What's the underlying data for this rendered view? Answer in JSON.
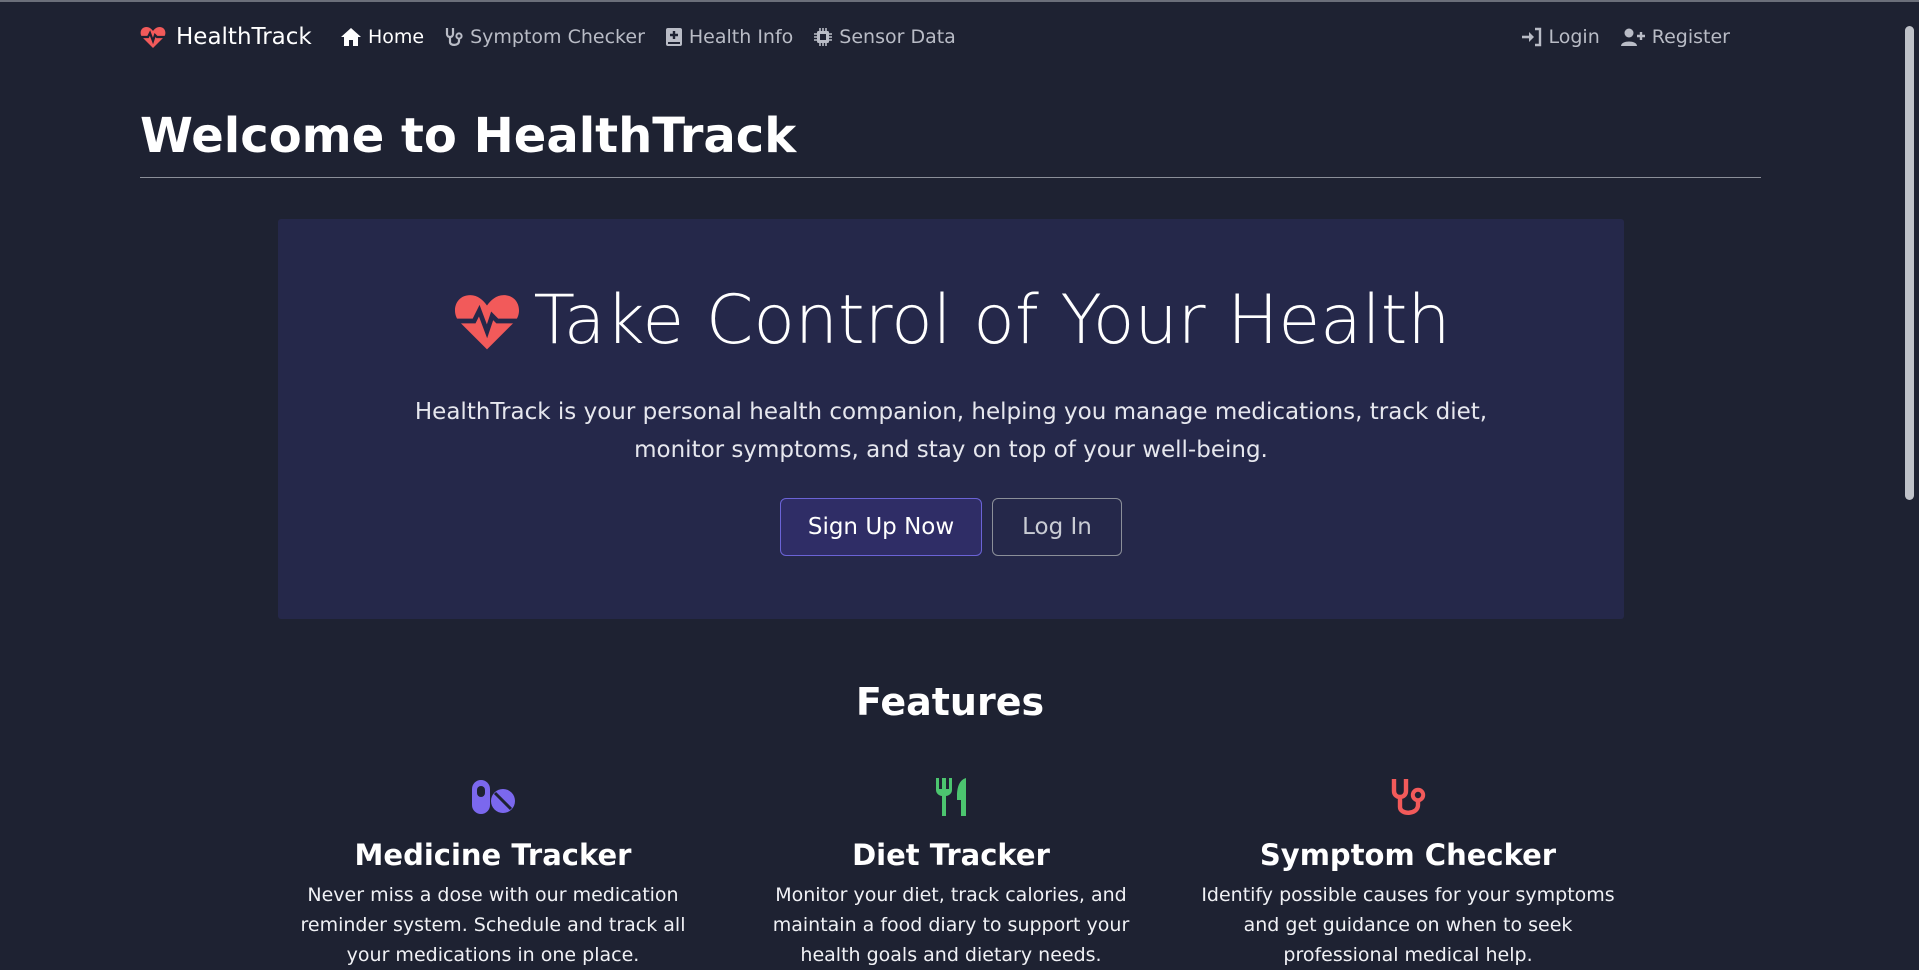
{
  "navbar": {
    "brand": "HealthTrack",
    "links": [
      {
        "label": "Home",
        "icon": "home-icon"
      },
      {
        "label": "Symptom Checker",
        "icon": "stethoscope-icon"
      },
      {
        "label": "Health Info",
        "icon": "medical-book-icon"
      },
      {
        "label": "Sensor Data",
        "icon": "chip-icon"
      }
    ],
    "login": "Login",
    "register": "Register"
  },
  "page": {
    "title": "Welcome to HealthTrack"
  },
  "hero": {
    "title": "Take Control of Your Health",
    "text": "HealthTrack is your personal health companion, helping you manage medications, track diet, monitor symptoms, and stay on top of your well-being.",
    "signup_label": "Sign Up Now",
    "login_label": "Log In"
  },
  "features": {
    "title": "Features",
    "items": [
      {
        "title": "Medicine Tracker",
        "text": "Never miss a dose with our medication reminder system. Schedule and track all your medications in one place.",
        "icon": "pills-icon",
        "color": "#7b68ee"
      },
      {
        "title": "Diet Tracker",
        "text": "Monitor your diet, track calories, and maintain a food diary to support your health goals and dietary needs.",
        "icon": "utensils-icon",
        "color": "#4cc56f"
      },
      {
        "title": "Symptom Checker",
        "text": "Identify possible causes for your symptoms and get guidance on when to seek professional medical help.",
        "icon": "stethoscope-icon",
        "color": "#f25a5a"
      }
    ]
  },
  "colors": {
    "background": "#1e2232",
    "hero_bg": "#25284a",
    "accent_red": "#f25a5a",
    "primary_button": "#2f2d66"
  }
}
